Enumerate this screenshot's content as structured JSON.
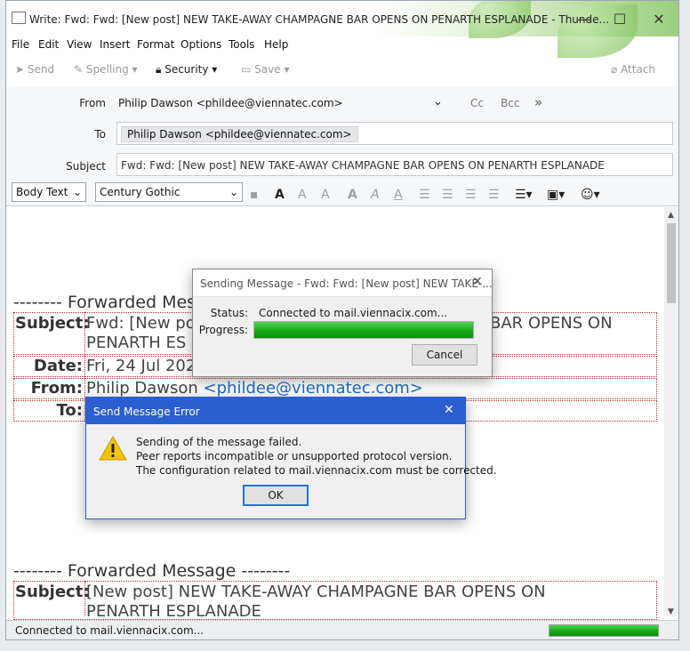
{
  "window": {
    "title": "Write: Fwd: Fwd: [New post] NEW TAKE-AWAY CHAMPAGNE BAR OPENS ON PENARTH ESPLANADE - Thunde...",
    "minimize": "—",
    "maximize": "☐",
    "close": "✕"
  },
  "menu": [
    "File",
    "Edit",
    "View",
    "Insert",
    "Format",
    "Options",
    "Tools",
    "Help"
  ],
  "toolbar": {
    "send": "Send",
    "spelling": "Spelling",
    "security": "Security",
    "save": "Save",
    "attach": "Attach"
  },
  "compose": {
    "from_label": "From",
    "from_value": "Philip Dawson <phildee@viennatec.com>",
    "cc": "Cc",
    "bcc": "Bcc",
    "to_label": "To",
    "to_value": "Philip Dawson <phildee@viennatec.com>",
    "subject_label": "Subject",
    "subject_value": "Fwd: Fwd: [New post] NEW TAKE-AWAY CHAMPAGNE BAR OPENS ON PENARTH ESPLANADE"
  },
  "format": {
    "paragraph": "Body Text",
    "font": "Century Gothic"
  },
  "body": {
    "fwd1": "-------- Forwarded Mess",
    "subject_key": "Subject:",
    "subject_val_a": "Fwd: [New pos",
    "subject_val_b": "BAR OPENS ON",
    "subject_val_c": "PENARTH ES",
    "date_key": "Date:",
    "date_val": "Fri, 24 Jul 202",
    "from_key": "From:",
    "from_name": "Philip Dawson ",
    "from_email": "<phildee@viennatec.com>",
    "to_key": "To:",
    "fwd2": "-------- Forwarded Message --------",
    "subject2_key": "Subject:",
    "subject2_val_a": "[New post] NEW TAKE-AWAY CHAMPAGNE BAR OPENS ON",
    "subject2_val_b": "PENARTH ESPLANADE"
  },
  "status_bar": {
    "text": "Connected to mail.viennacix.com...",
    "progress": 1.0
  },
  "sending_dialog": {
    "title": "Sending Message - Fwd: Fwd: [New post] NEW TAKE-...",
    "status_label": "Status:",
    "status_value": "Connected to mail.viennacix.com...",
    "progress_label": "Progress:",
    "progress": 1.0,
    "cancel": "Cancel"
  },
  "error_dialog": {
    "title": "Send Message Error",
    "line1": "Sending of the message failed.",
    "line2": "Peer reports incompatible or unsupported protocol version.",
    "line3": "The configuration related to mail.viennacix.com must be corrected.",
    "ok": "OK",
    "header_color": "#2b5fd1"
  }
}
